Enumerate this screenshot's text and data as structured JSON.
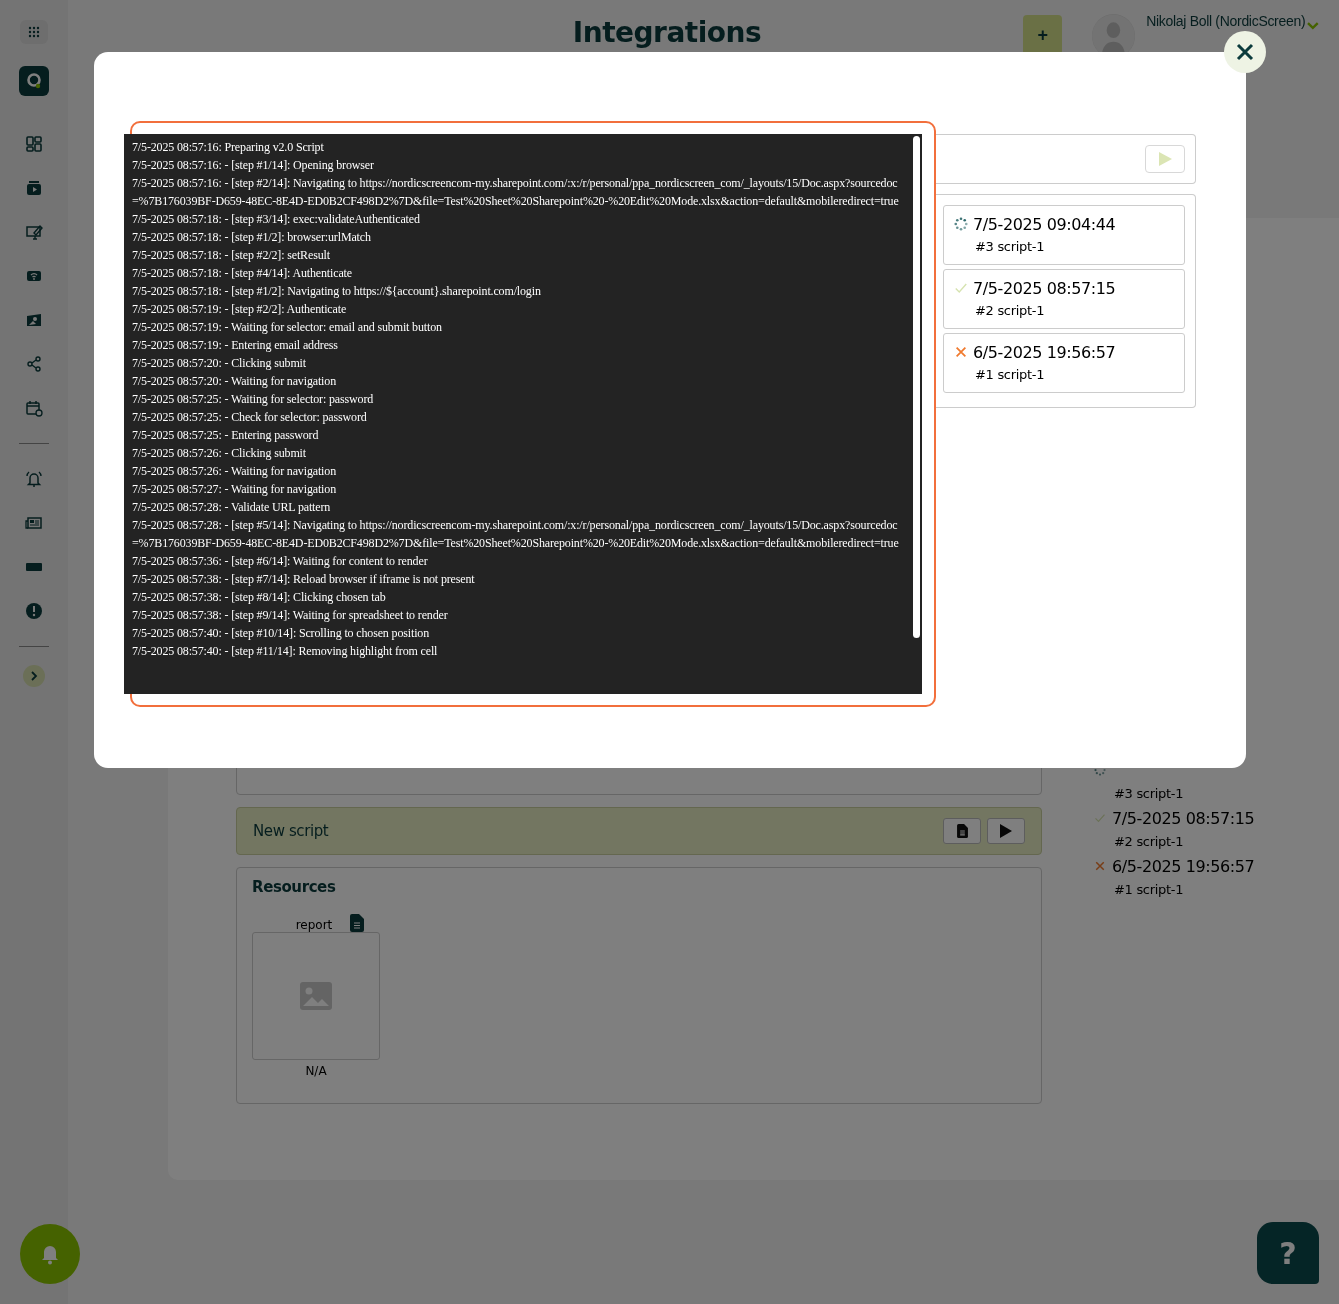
{
  "header": {
    "title": "Integrations",
    "add_button": "+",
    "user_name": "Nikolaj Boll (NordicScreen)"
  },
  "script_bar": {
    "title": "New script"
  },
  "resources": {
    "title": "Resources",
    "items": [
      {
        "label": "report",
        "caption": "N/A"
      }
    ]
  },
  "background_runs": [
    {
      "kind": "running",
      "label": "#3 script-1"
    },
    {
      "kind": "success",
      "time": "7/5-2025 08:57:15",
      "label": "#2 script-1"
    },
    {
      "kind": "failed",
      "time": "6/5-2025 19:56:57",
      "label": "#1 script-1"
    }
  ],
  "dialog": {
    "log_lines": [
      "7/5-2025 08:57:16: Preparing v2.0 Script",
      "7/5-2025 08:57:16: - [step #1/14]: Opening browser",
      "7/5-2025 08:57:16: - [step #2/14]: Navigating to https://nordicscreencom-my.sharepoint.com/:x:/r/personal/ppa_nordicscreen_com/_layouts/15/Doc.aspx?sourcedoc=%7B176039BF-D659-48EC-8E4D-ED0B2CF498D2%7D&file=Test%20Sheet%20Sharepoint%20-%20Edit%20Mode.xlsx&action=default&mobileredirect=true",
      "7/5-2025 08:57:18: - [step #3/14]: exec:validateAuthenticated",
      "7/5-2025 08:57:18: - [step #1/2]: browser:urlMatch",
      "7/5-2025 08:57:18: - [step #2/2]: setResult",
      "7/5-2025 08:57:18: - [step #4/14]: Authenticate",
      "7/5-2025 08:57:18: - [step #1/2]: Navigating to https://${account}.sharepoint.com/login",
      "7/5-2025 08:57:19: - [step #2/2]: Authenticate",
      "7/5-2025 08:57:19: - Waiting for selector: email and submit button",
      "7/5-2025 08:57:19: - Entering email address",
      "7/5-2025 08:57:20: - Clicking submit",
      "7/5-2025 08:57:20: - Waiting for navigation",
      "7/5-2025 08:57:25: - Waiting for selector: password",
      "7/5-2025 08:57:25: - Check for selector: password",
      "7/5-2025 08:57:25: - Entering password",
      "7/5-2025 08:57:26: - Clicking submit",
      "7/5-2025 08:57:26: - Waiting for navigation",
      "7/5-2025 08:57:27: - Waiting for navigation",
      "7/5-2025 08:57:28: - Validate URL pattern",
      "7/5-2025 08:57:28: - [step #5/14]: Navigating to https://nordicscreencom-my.sharepoint.com/:x:/r/personal/ppa_nordicscreen_com/_layouts/15/Doc.aspx?sourcedoc=%7B176039BF-D659-48EC-8E4D-ED0B2CF498D2%7D&file=Test%20Sheet%20Sharepoint%20-%20Edit%20Mode.xlsx&action=default&mobileredirect=true",
      "7/5-2025 08:57:36: - [step #6/14]: Waiting for content to render",
      "7/5-2025 08:57:38: - [step #7/14]: Reload browser if iframe is not present",
      "7/5-2025 08:57:38: - [step #8/14]: Clicking chosen tab",
      "7/5-2025 08:57:38: - [step #9/14]: Waiting for spreadsheet to render",
      "7/5-2025 08:57:40: - [step #10/14]: Scrolling to chosen position",
      "7/5-2025 08:57:40: - [step #11/14]: Removing highlight from cell"
    ],
    "runs": [
      {
        "kind": "running",
        "time": "7/5-2025 09:04:44",
        "label": "#3 script-1"
      },
      {
        "kind": "success",
        "time": "7/5-2025 08:57:15",
        "label": "#2 script-1"
      },
      {
        "kind": "failed",
        "time": "6/5-2025 19:56:57",
        "label": "#1 script-1"
      }
    ]
  },
  "help_button": "?"
}
